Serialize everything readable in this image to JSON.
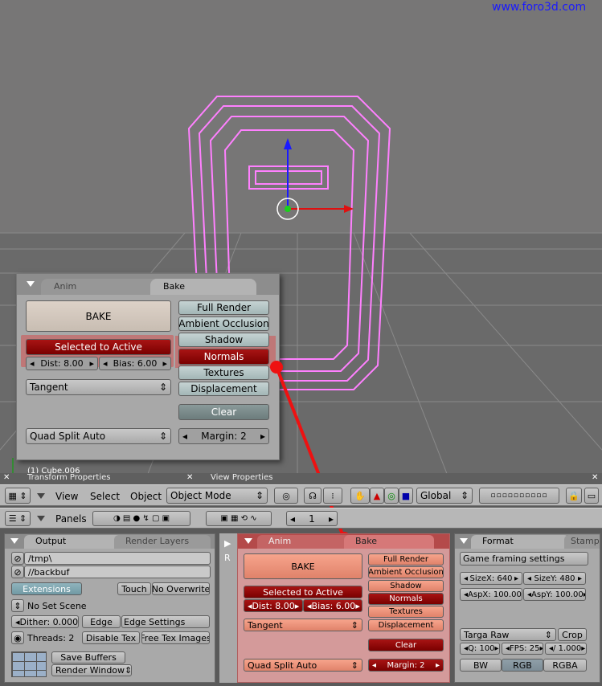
{
  "watermark": "www.foro3d.com",
  "viewport": {
    "object_label": "(1) Cube.006"
  },
  "floating_panel": {
    "tab_anim": "Anim",
    "tab_bake": "Bake",
    "bake": "BAKE",
    "selected_to_active": "Selected to Active",
    "dist_label": "Dist: 8.00",
    "bias_label": "Bias: 6.00",
    "normal_space": "Tangent",
    "quad_split": "Quad Split Auto",
    "modes": [
      "Full Render",
      "Ambient Occlusion",
      "Shadow",
      "Normals",
      "Textures",
      "Displacement"
    ],
    "clear": "Clear",
    "margin": "Margin: 2"
  },
  "view3d_header": {
    "transform_props": "Transform Properties",
    "view_props": "View Properties",
    "menu_view": "View",
    "menu_select": "Select",
    "menu_object": "Object",
    "mode": "Object Mode",
    "orientation": "Global"
  },
  "buttons_header": {
    "panels": "Panels",
    "frame": "1"
  },
  "output_panel": {
    "tab_output": "Output",
    "tab_render_layers": "Render Layers",
    "path1": "/tmp\\",
    "path2": "//backbuf",
    "extensions": "Extensions",
    "touch": "Touch",
    "no_overwrite": "No Overwrite",
    "no_set_scene": "No Set Scene",
    "dither": "Dither: 0.000",
    "edge": "Edge",
    "edge_settings": "Edge Settings",
    "threads": "Threads: 2",
    "disable_tex": "Disable Tex",
    "free_tex_images": "Free Tex Images",
    "save_buffers": "Save Buffers",
    "render_window": "Render Window"
  },
  "bake_panel": {
    "tab_anim": "Anim",
    "tab_bake": "Bake",
    "side_r": "R",
    "bake": "BAKE",
    "selected_to_active": "Selected to Active",
    "dist_label": "Dist: 8.00",
    "bias_label": "Bias: 6.00",
    "normal_space": "Tangent",
    "quad_split": "Quad Split Auto",
    "modes": [
      "Full Render",
      "Ambient Occlusion",
      "Shadow",
      "Normals",
      "Textures",
      "Displacement"
    ],
    "clear": "Clear",
    "margin": "Margin: 2"
  },
  "format_panel": {
    "tab_format": "Format",
    "tab_stamp": "Stamp",
    "preset": "Game framing settings",
    "sizex": "SizeX: 640",
    "sizey": "SizeY: 480",
    "aspx": "AspX: 100.00",
    "aspy": "AspY: 100.00",
    "file_type": "Targa Raw",
    "crop": "Crop",
    "quality": "Q: 100",
    "fps": "FPS: 25",
    "fps_base": "/ 1.000",
    "bw": "BW",
    "rgb": "RGB",
    "rgba": "RGBA"
  }
}
